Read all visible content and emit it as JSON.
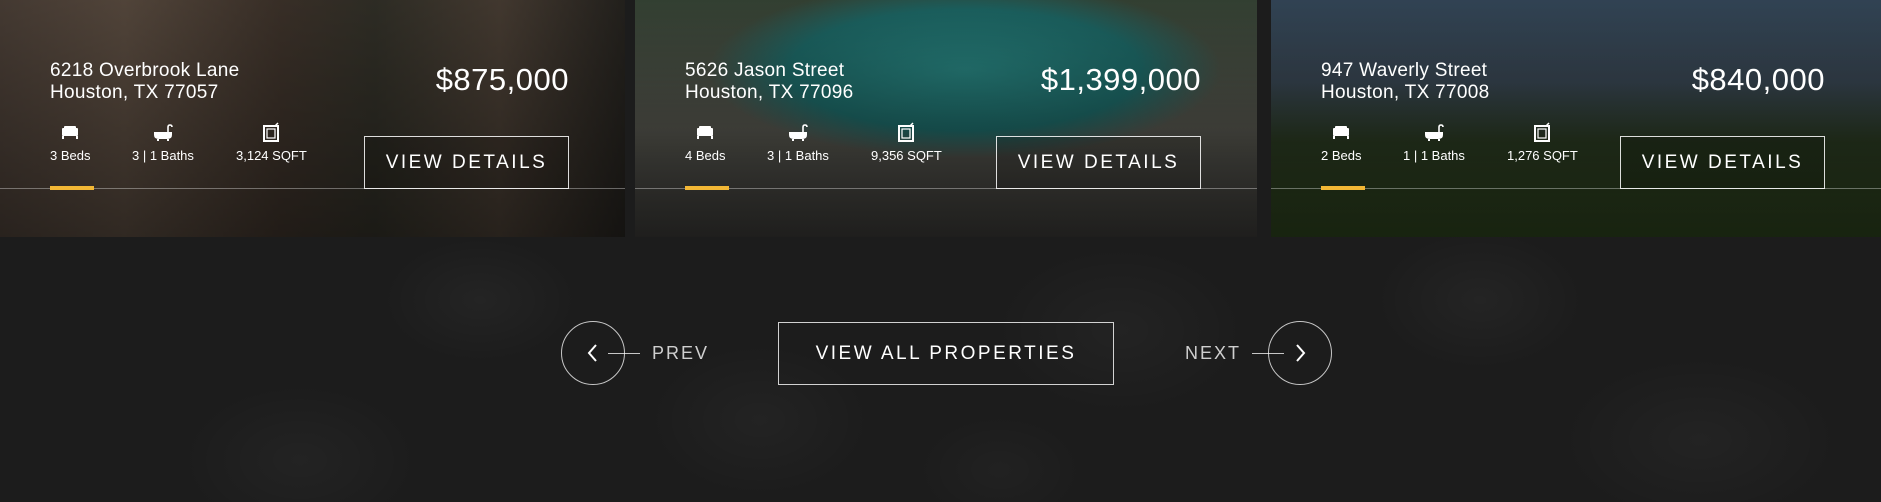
{
  "listings": [
    {
      "address_line1": "6218 Overbrook Lane",
      "address_line2": "Houston, TX 77057",
      "price": "$875,000",
      "beds": "3 Beds",
      "baths": "3 | 1 Baths",
      "sqft": "3,124 SQFT",
      "details_label": "VIEW DETAILS"
    },
    {
      "address_line1": "5626 Jason Street",
      "address_line2": "Houston, TX 77096",
      "price": "$1,399,000",
      "beds": "4 Beds",
      "baths": "3 | 1 Baths",
      "sqft": "9,356 SQFT",
      "details_label": "VIEW DETAILS"
    },
    {
      "address_line1": "947 Waverly Street",
      "address_line2": "Houston, TX 77008",
      "price": "$840,000",
      "beds": "2 Beds",
      "baths": "1 | 1 Baths",
      "sqft": "1,276 SQFT",
      "details_label": "VIEW DETAILS"
    }
  ],
  "nav": {
    "prev_label": "PREV",
    "next_label": "NEXT",
    "view_all_label": "VIEW ALL PROPERTIES"
  },
  "icons": {
    "beds": "bed-icon",
    "baths": "bathtub-icon",
    "sqft": "floor-plan-icon",
    "prev": "chevron-left-icon",
    "next": "chevron-right-icon"
  },
  "colors": {
    "accent": "#f2b735",
    "background": "#1c1c1c",
    "text": "#ffffff"
  }
}
